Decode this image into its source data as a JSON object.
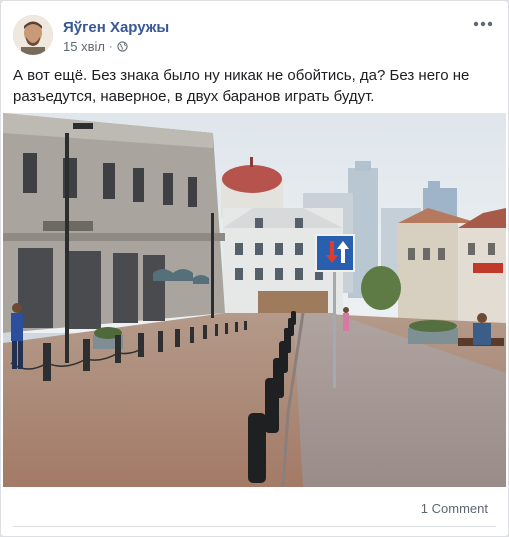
{
  "post": {
    "author_name": "Яўген Харужы",
    "time": "15 хвіл",
    "separator": "·",
    "privacy_icon": "globe-icon",
    "more_icon": "more-options-icon",
    "text": "А вот ещё. Без знака было ну никак не обойтись, да? Без него не разъедутся, наверное, в двух баранов играть будут.",
    "photo_icon": "street-photo",
    "comments_label": "1 Comment"
  },
  "colors": {
    "author_link": "#385898",
    "meta_text": "#616770",
    "body_text": "#1c1e21",
    "sign_blue": "#2a5fb0"
  }
}
